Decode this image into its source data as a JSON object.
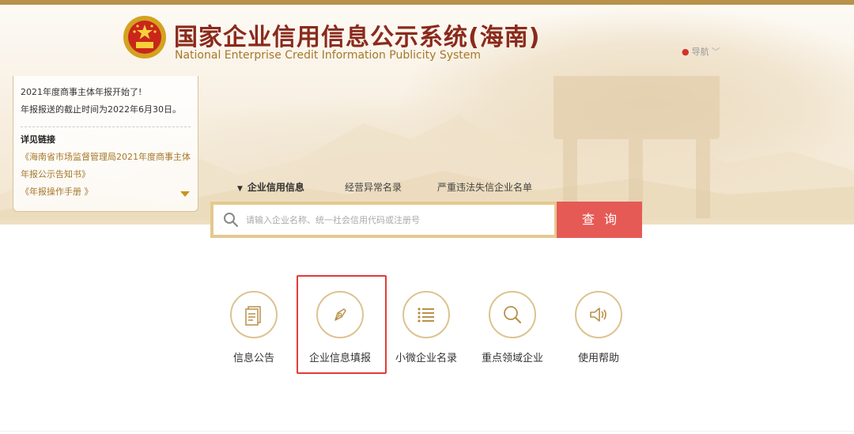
{
  "header": {
    "title": "国家企业信用信息公示系统(海南)",
    "subtitle": "National Enterprise Credit Information Publicity System",
    "nav_label": "导航"
  },
  "notice": {
    "line1": "2021年度商事主体年报开始了!",
    "line2": "年报报送的截止时间为2022年6月30日。",
    "links_title": "详见链接",
    "link1_line1": "《海南省市场监督管理局2021年度商事主体",
    "link1_line2": "年报公示告知书》",
    "link2": "《年报操作手册 》"
  },
  "tabs": [
    {
      "label": "企业信用信息",
      "active": true
    },
    {
      "label": "经营异常名录",
      "active": false
    },
    {
      "label": "严重违法失信企业名单",
      "active": false
    }
  ],
  "search": {
    "placeholder": "请输入企业名称、统一社会信用代码或注册号",
    "button_label": "查询"
  },
  "features": [
    {
      "label": "信息公告",
      "icon": "document-icon"
    },
    {
      "label": "企业信息填报",
      "icon": "pen-icon",
      "highlighted": true
    },
    {
      "label": "小微企业名录",
      "icon": "list-icon"
    },
    {
      "label": "重点领域企业",
      "icon": "magnifier-icon"
    },
    {
      "label": "使用帮助",
      "icon": "speaker-icon"
    }
  ],
  "colors": {
    "gold": "#a57828",
    "title_red": "#8a2a1c",
    "search_button": "#e65a56",
    "highlight_red": "#e23b37"
  }
}
